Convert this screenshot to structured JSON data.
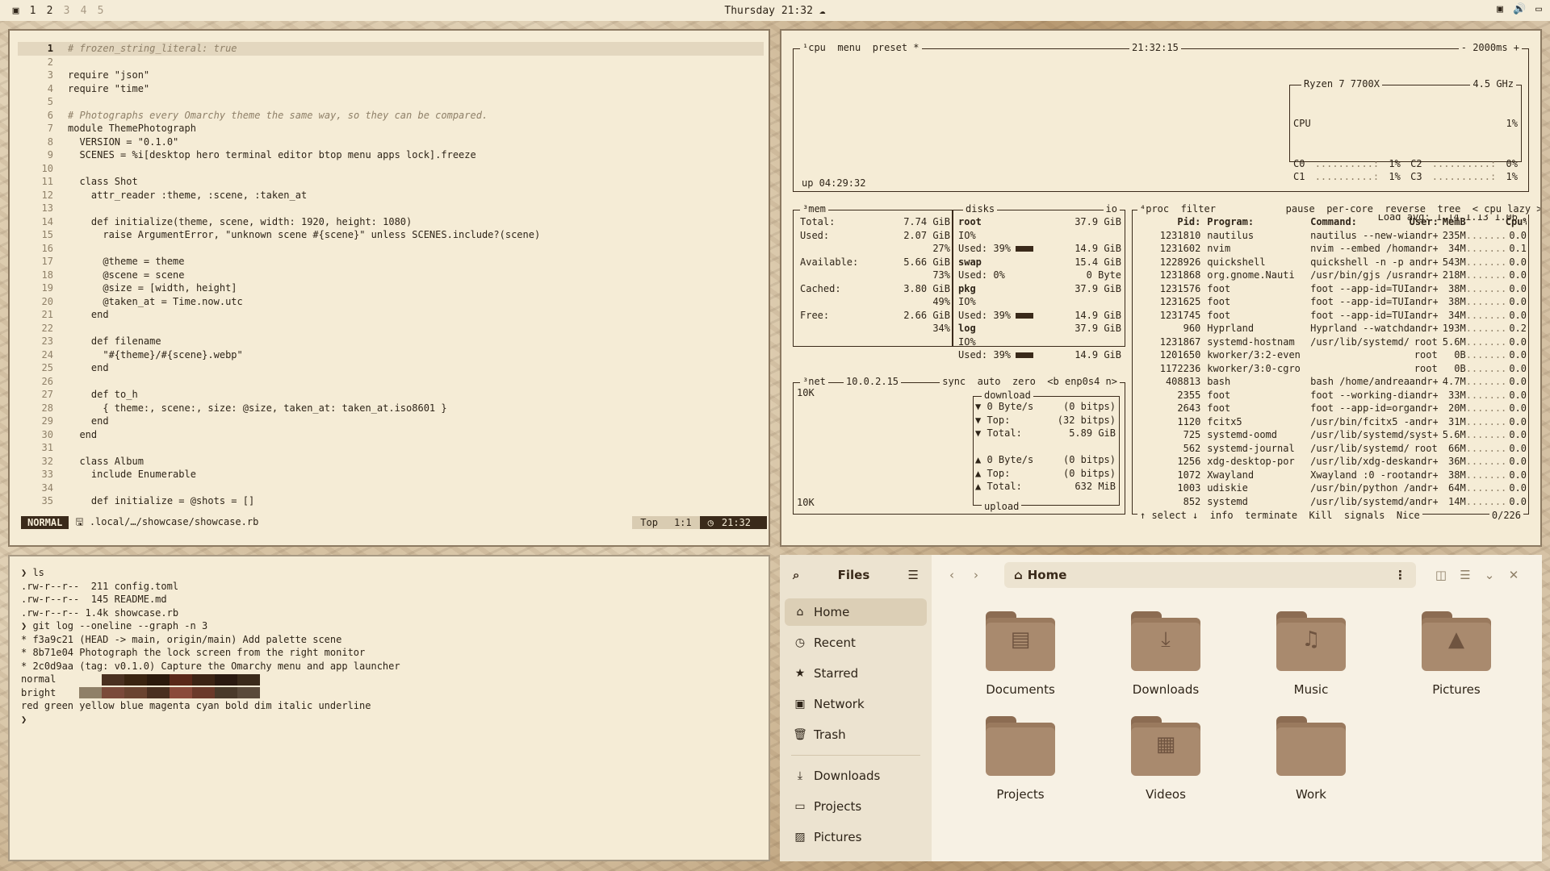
{
  "topbar": {
    "workspaces": [
      "1",
      "2",
      "3",
      "4",
      "5"
    ],
    "clock": "Thursday 21:32"
  },
  "editor": {
    "lines": [
      {
        "n": "1",
        "t": "# frozen_string_literal: true",
        "cls": "comment",
        "cur": true
      },
      {
        "n": "2",
        "t": ""
      },
      {
        "n": "3",
        "t": "require \"json\""
      },
      {
        "n": "4",
        "t": "require \"time\""
      },
      {
        "n": "5",
        "t": ""
      },
      {
        "n": "6",
        "t": "# Photographs every Omarchy theme the same way, so they can be compared.",
        "cls": "comment"
      },
      {
        "n": "7",
        "t": "module ThemePhotograph"
      },
      {
        "n": "8",
        "t": "  VERSION = \"0.1.0\""
      },
      {
        "n": "9",
        "t": "  SCENES = %i[desktop hero terminal editor btop menu apps lock].freeze"
      },
      {
        "n": "10",
        "t": ""
      },
      {
        "n": "11",
        "t": "  class Shot"
      },
      {
        "n": "12",
        "t": "    attr_reader :theme, :scene, :taken_at"
      },
      {
        "n": "13",
        "t": ""
      },
      {
        "n": "14",
        "t": "    def initialize(theme, scene, width: 1920, height: 1080)"
      },
      {
        "n": "15",
        "t": "      raise ArgumentError, \"unknown scene #{scene}\" unless SCENES.include?(scene)"
      },
      {
        "n": "16",
        "t": ""
      },
      {
        "n": "17",
        "t": "      @theme = theme"
      },
      {
        "n": "18",
        "t": "      @scene = scene"
      },
      {
        "n": "19",
        "t": "      @size = [width, height]"
      },
      {
        "n": "20",
        "t": "      @taken_at = Time.now.utc"
      },
      {
        "n": "21",
        "t": "    end"
      },
      {
        "n": "22",
        "t": ""
      },
      {
        "n": "23",
        "t": "    def filename"
      },
      {
        "n": "24",
        "t": "      \"#{theme}/#{scene}.webp\""
      },
      {
        "n": "25",
        "t": "    end"
      },
      {
        "n": "26",
        "t": ""
      },
      {
        "n": "27",
        "t": "    def to_h"
      },
      {
        "n": "28",
        "t": "      { theme:, scene:, size: @size, taken_at: taken_at.iso8601 }"
      },
      {
        "n": "29",
        "t": "    end"
      },
      {
        "n": "30",
        "t": "  end"
      },
      {
        "n": "31",
        "t": ""
      },
      {
        "n": "32",
        "t": "  class Album"
      },
      {
        "n": "33",
        "t": "    include Enumerable"
      },
      {
        "n": "34",
        "t": ""
      },
      {
        "n": "35",
        "t": "    def initialize = @shots = []"
      }
    ],
    "status": {
      "mode": "NORMAL",
      "path": ".local/…/showcase/showcase.rb",
      "scroll": "Top",
      "position": "1:1",
      "time": "21:32"
    }
  },
  "btop": {
    "cpu": {
      "header": "¹cpu  menu  preset *",
      "clock": "21:32:15",
      "interval": "- 2000ms +",
      "uptime": "up 04:29:32",
      "model": "Ryzen 7 7700X",
      "freq": "4.5 GHz",
      "cpu_label": "CPU",
      "cpu_pct": "1%",
      "cores": [
        {
          "a": "C0",
          "ap": "1%",
          "b": "C2",
          "bp": "0%"
        },
        {
          "a": "C1",
          "ap": "1%",
          "b": "C3",
          "bp": "1%"
        }
      ],
      "load": "Load avg: 1.14 1.13 1.06"
    },
    "mem": {
      "header": "³mem",
      "rows": [
        {
          "k": "Total:",
          "v": "7.74 GiB"
        },
        {
          "k": "Used:",
          "v": "2.07 GiB"
        },
        {
          "k": "",
          "v": "27%"
        },
        {
          "k": "Available:",
          "v": "5.66 GiB"
        },
        {
          "k": "",
          "v": "73%"
        },
        {
          "k": "Cached:",
          "v": "3.80 GiB"
        },
        {
          "k": "",
          "v": "49%"
        },
        {
          "k": "Free:",
          "v": "2.66 GiB"
        },
        {
          "k": "",
          "v": "34%"
        }
      ]
    },
    "disks": {
      "header": "disks",
      "io": "io",
      "items": [
        {
          "name": "root",
          "size": "37.9 GiB",
          "io": "IO%",
          "used": "Used: 39%",
          "free": "14.9 GiB"
        },
        {
          "name": "swap",
          "size": "15.4 GiB",
          "io": "Used: 0%",
          "used": "",
          "free": "0 Byte"
        },
        {
          "name": "pkg",
          "size": "37.9 GiB",
          "io": "IO%",
          "used": "Used: 39%",
          "free": "14.9 GiB"
        },
        {
          "name": "log",
          "size": "37.9 GiB",
          "io": "IO%",
          "used": "Used: 39%",
          "free": "14.9 GiB"
        }
      ]
    },
    "net": {
      "header": "³net",
      "ip": "10.0.2.15",
      "opts": "sync  auto  zero  <b enp0s4 n>",
      "scale_top": "10K",
      "scale_bottom": "10K",
      "download_label": "download",
      "upload_label": "upload",
      "down": [
        {
          "k": "▼ 0 Byte/s",
          "v": "(0 bitps)"
        },
        {
          "k": "▼ Top:",
          "v": "(32 bitps)"
        },
        {
          "k": "▼ Total:",
          "v": "5.89 GiB"
        }
      ],
      "up": [
        {
          "k": "▲ 0 Byte/s",
          "v": "(0 bitps)"
        },
        {
          "k": "▲ Top:",
          "v": "(0 bitps)"
        },
        {
          "k": "▲ Total:",
          "v": "632 MiB"
        }
      ]
    },
    "proc": {
      "header": "⁴proc  filter            pause  per-core  reverse  tree  < cpu lazy >",
      "cols": {
        "pid": "Pid:",
        "prog": "Program:",
        "cmd": "Command:",
        "user": "User:",
        "mem": "MemB",
        "cpu": "Cpu%"
      },
      "rows": [
        {
          "pid": "1231810",
          "prog": "nautilus",
          "cmd": "nautilus --new-win",
          "user": "andr+",
          "mem": "235M",
          "cpu": "0.0"
        },
        {
          "pid": "1231602",
          "prog": "nvim",
          "cmd": "nvim --embed /home",
          "user": "andr+",
          "mem": "34M",
          "cpu": "0.1"
        },
        {
          "pid": "1228926",
          "prog": "quickshell",
          "cmd": "quickshell -n -p /",
          "user": "andr+",
          "mem": "543M",
          "cpu": "0.0"
        },
        {
          "pid": "1231868",
          "prog": "org.gnome.Nauti",
          "cmd": "/usr/bin/gjs /usr/",
          "user": "andr+",
          "mem": "218M",
          "cpu": "0.0"
        },
        {
          "pid": "1231576",
          "prog": "foot",
          "cmd": "foot --app-id=TUI.",
          "user": "andr+",
          "mem": "38M",
          "cpu": "0.0"
        },
        {
          "pid": "1231625",
          "prog": "foot",
          "cmd": "foot --app-id=TUI.",
          "user": "andr+",
          "mem": "38M",
          "cpu": "0.0"
        },
        {
          "pid": "1231745",
          "prog": "foot",
          "cmd": "foot --app-id=TUI.",
          "user": "andr+",
          "mem": "34M",
          "cpu": "0.0"
        },
        {
          "pid": "960",
          "prog": "Hyprland",
          "cmd": "Hyprland --watchdo",
          "user": "andr+",
          "mem": "193M",
          "cpu": "0.2"
        },
        {
          "pid": "1231867",
          "prog": "systemd-hostnam",
          "cmd": "/usr/lib/systemd/s",
          "user": "root",
          "mem": "5.6M",
          "cpu": "0.0"
        },
        {
          "pid": "1201650",
          "prog": "kworker/3:2-even",
          "cmd": "",
          "user": "root",
          "mem": "0B",
          "cpu": "0.0"
        },
        {
          "pid": "1172236",
          "prog": "kworker/3:0-cgro",
          "cmd": "",
          "user": "root",
          "mem": "0B",
          "cpu": "0.0"
        },
        {
          "pid": "408813",
          "prog": "bash",
          "cmd": "bash /home/andreas",
          "user": "andr+",
          "mem": "4.7M",
          "cpu": "0.0"
        },
        {
          "pid": "2355",
          "prog": "foot",
          "cmd": "foot --working-dir",
          "user": "andr+",
          "mem": "33M",
          "cpu": "0.0"
        },
        {
          "pid": "2643",
          "prog": "foot",
          "cmd": "foot --app-id=org.",
          "user": "andr+",
          "mem": "20M",
          "cpu": "0.0"
        },
        {
          "pid": "1120",
          "prog": "fcitx5",
          "cmd": "/usr/bin/fcitx5 --",
          "user": "andr+",
          "mem": "31M",
          "cpu": "0.0"
        },
        {
          "pid": "725",
          "prog": "systemd-oomd",
          "cmd": "/usr/lib/systemd/s",
          "user": "syst+",
          "mem": "5.6M",
          "cpu": "0.0"
        },
        {
          "pid": "562",
          "prog": "systemd-journal",
          "cmd": "/usr/lib/systemd/s",
          "user": "root",
          "mem": "66M",
          "cpu": "0.0"
        },
        {
          "pid": "1256",
          "prog": "xdg-desktop-por",
          "cmd": "/usr/lib/xdg-deskt",
          "user": "andr+",
          "mem": "36M",
          "cpu": "0.0"
        },
        {
          "pid": "1072",
          "prog": "Xwayland",
          "cmd": "Xwayland :0 -rootl",
          "user": "andr+",
          "mem": "38M",
          "cpu": "0.0"
        },
        {
          "pid": "1003",
          "prog": "udiskie",
          "cmd": "/usr/bin/python /u",
          "user": "andr+",
          "mem": "64M",
          "cpu": "0.0"
        },
        {
          "pid": "852",
          "prog": "systemd",
          "cmd": "/usr/lib/systemd/s",
          "user": "andr+",
          "mem": "14M",
          "cpu": "0.0"
        }
      ],
      "footer": "↑ select ↓  info  terminate  Kill  signals  Nice",
      "count": "0/226"
    }
  },
  "terminal": {
    "lines": [
      "❯ ls",
      ".rw-r--r--  211 config.toml",
      ".rw-r--r--  145 README.md",
      ".rw-r--r-- 1.4k showcase.rb",
      "❯ git log --oneline --graph -n 3",
      "* f3a9c21 (HEAD -> main, origin/main) Add palette scene",
      "* 8b71e04 Photograph the lock screen from the right monitor",
      "* 2c0d9aa (tag: v0.1.0) Capture the Omarchy menu and app launcher"
    ],
    "normal_label": "normal",
    "bright_label": "bright",
    "normal_colors": [
      "#f5ecd6",
      "#4a3020",
      "#3a2410",
      "#2b1a0c",
      "#5a2818",
      "#3c2414",
      "#2a1a10",
      "#3a2a1a"
    ],
    "bright_colors": [
      "#8f8068",
      "#7a4a3a",
      "#6a4430",
      "#4a3020",
      "#8a4a3a",
      "#6b3a2a",
      "#4a3a2a",
      "#5a4a3a"
    ],
    "styles": "red green yellow blue magenta cyan bold dim italic underline",
    "prompt": "❯"
  },
  "files": {
    "title": "Files",
    "location": "Home",
    "sidebar": [
      {
        "label": "Home",
        "icon": "home-icon",
        "glyph": "⌂",
        "sel": true
      },
      {
        "label": "Recent",
        "icon": "clock-icon",
        "glyph": "◷"
      },
      {
        "label": "Starred",
        "icon": "star-icon",
        "glyph": "★"
      },
      {
        "label": "Network",
        "icon": "network-icon",
        "glyph": "▣"
      },
      {
        "label": "Trash",
        "icon": "trash-icon",
        "glyph": "🗑"
      }
    ],
    "bookmarks": [
      {
        "label": "Downloads",
        "icon": "download-icon",
        "glyph": "⤓"
      },
      {
        "label": "Projects",
        "icon": "folder-icon",
        "glyph": "▭"
      },
      {
        "label": "Pictures",
        "icon": "image-icon",
        "glyph": "▨"
      }
    ],
    "folders": [
      {
        "label": "Documents",
        "glyph": "▤"
      },
      {
        "label": "Downloads",
        "glyph": "⤓"
      },
      {
        "label": "Music",
        "glyph": "♫"
      },
      {
        "label": "Pictures",
        "glyph": "▲"
      },
      {
        "label": "Projects",
        "glyph": ""
      },
      {
        "label": "Videos",
        "glyph": "▦"
      },
      {
        "label": "Work",
        "glyph": ""
      }
    ]
  }
}
